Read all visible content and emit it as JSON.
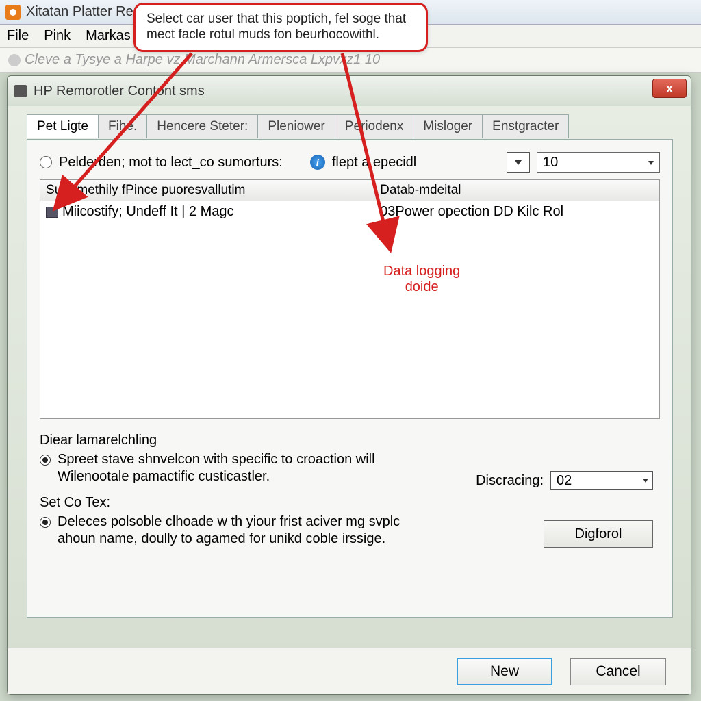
{
  "outer": {
    "title": "Xitatan Platter Re"
  },
  "menubar": {
    "items": [
      "File",
      "Pink",
      "Markas"
    ]
  },
  "breadcrumb": {
    "text": "Cleve a Tysye a  Harpe  vz Marchann Armersca Lxpvxz1 10"
  },
  "dialog": {
    "title": "HP Remorotler Contont sms",
    "close_label": "x",
    "tabs": [
      "Pet Ligte",
      "Fihe.",
      "Hencere Steter:",
      "Pleniower",
      "Periodenx",
      "Misloger",
      "Enstgracter"
    ],
    "active_tab_index": 0,
    "toprow": {
      "radio_label": "Pelderden; mot to lect_co sumorturs:",
      "info_label": "flept a epecidl",
      "num_value": "10"
    },
    "list": {
      "headers": [
        "Sutermethily fPince puoresvallutim",
        "Datab-mdeital"
      ],
      "rows": [
        {
          "c1": "Miicostify; Undeff It | 2 Magc",
          "c2": "03Power opection DD Kilc Rol"
        }
      ]
    },
    "bottom": {
      "group1_title": "Diear lamarelchling",
      "group1_option": "Spreet stave shnvelcon with specific to croaction will Wilenootale pamactific custicastler.",
      "group2_title": "Set Co Tex:",
      "group2_option": "Deleces polsoble clhoade w th yiour frist aciver mg svplc ahoun name, doully to agamed for unikd coble irssige.",
      "discracing_label": "Discracing:",
      "discracing_value": "02",
      "digforol_label": "Digforol"
    },
    "footer": {
      "primary": "New",
      "secondary": "Cancel"
    }
  },
  "callout": {
    "text": "Select car user that this poptich, fel soge that mect facle rotul muds fon beurhocowithl."
  },
  "annotation": {
    "text1": "Data logging",
    "text2": "doide"
  }
}
